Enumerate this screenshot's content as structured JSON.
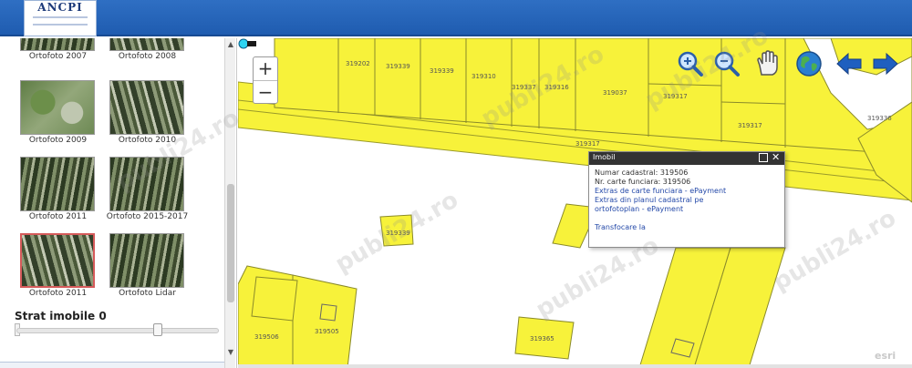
{
  "header": {
    "logo_text": "ANCPI"
  },
  "sidebar": {
    "thumbnails": [
      {
        "label": "Ortofoto 2007",
        "selected": false
      },
      {
        "label": "Ortofoto 2008",
        "selected": false
      },
      {
        "label": "Ortofoto 2009",
        "selected": false
      },
      {
        "label": "Ortofoto 2010",
        "selected": false
      },
      {
        "label": "Ortofoto 2011",
        "selected": false
      },
      {
        "label": "Ortofoto 2015-2017",
        "selected": false
      },
      {
        "label": "Ortofoto 2011",
        "selected": true
      },
      {
        "label": "Ortofoto Lidar",
        "selected": false
      }
    ],
    "opacity_label": "Strat imobile",
    "opacity_value": "0",
    "opacity_level": 0.7
  },
  "map": {
    "zoom_in_label": "+",
    "zoom_out_label": "−",
    "toolbar": [
      "zoom-in-icon",
      "zoom-out-icon",
      "pan-hand-icon",
      "globe-icon",
      "arrow-left-icon",
      "arrow-right-icon"
    ],
    "parcel_color": "#f7f23a",
    "parcel_labels": [
      "319202",
      "319339",
      "319339",
      "319310",
      "319337",
      "319316",
      "319037",
      "319317",
      "319317",
      "319336",
      "319317",
      "319339",
      "319365",
      "319505",
      "319506"
    ],
    "popup": {
      "title": "Imobil",
      "number_line": "Numar cadastral: 319506",
      "cf_line": "Nr. carte funciara: 319506",
      "link_extras_cf": "Extras de carte funciara - ePayment",
      "link_extras_plan_1": "Extras din planul cadastral pe",
      "link_extras_plan_2": "ortofotoplan - ePayment",
      "link_transfer": "Transfocare la"
    },
    "attribution": "esri",
    "watermark": "publi24.ro"
  }
}
